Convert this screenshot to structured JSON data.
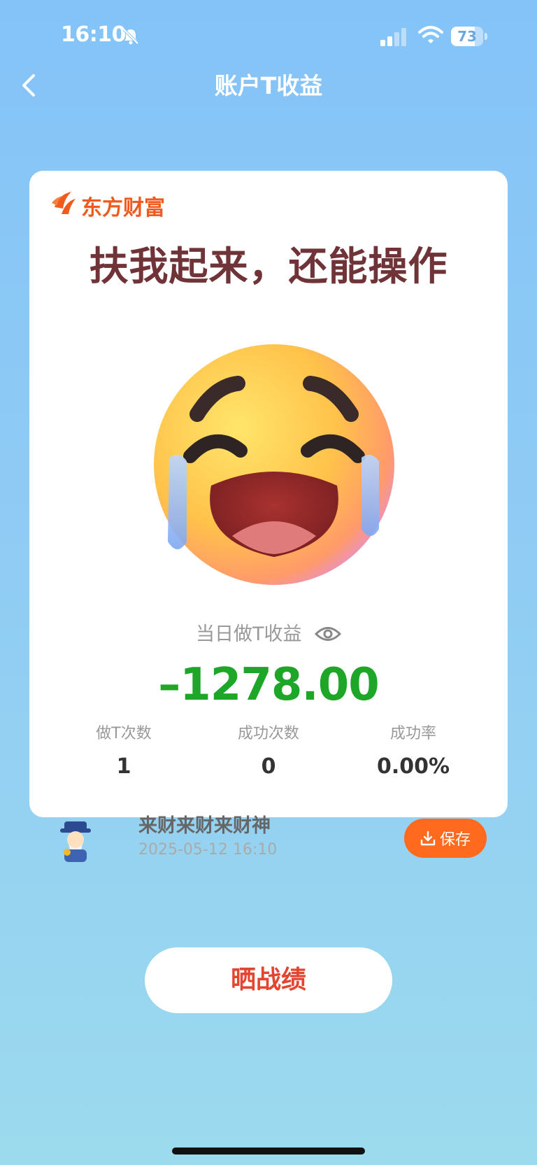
{
  "status_bar": {
    "time": "16:10",
    "battery_percent": 73,
    "battery_label": "73",
    "icons": [
      "bell-muted-icon",
      "cellular-signal-icon",
      "wifi-icon",
      "battery-icon"
    ]
  },
  "nav": {
    "title": "账户T收益",
    "back_icon": "chevron-left-icon"
  },
  "card": {
    "brand_name": "东方财富",
    "headline": "扶我起来，还能操作",
    "emoji": "crying-face-emoji",
    "metric_label": "当日做T收益",
    "metric_value": "–1278.00",
    "stats": [
      {
        "label": "做T次数",
        "value": "1"
      },
      {
        "label": "成功次数",
        "value": "0"
      },
      {
        "label": "成功率",
        "value": "0.00%"
      }
    ],
    "user": {
      "name": "来财来财来财神",
      "timestamp": "2025-05-12 16:10"
    },
    "save_label": "保存"
  },
  "share_label": "晒战绩",
  "colors": {
    "background_top": "#84c3f8",
    "background_bottom": "#9cdaee",
    "loss_green": "#1ea628",
    "brand_orange": "#f2591c",
    "save_button": "#ff6a1f",
    "share_text": "#e5452f",
    "headline": "#6f3338"
  }
}
